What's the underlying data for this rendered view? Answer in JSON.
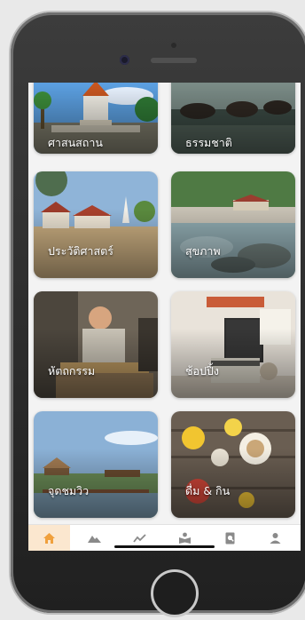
{
  "categories": [
    {
      "label": "ศาสนสถาน"
    },
    {
      "label": "ธรรมชาติ"
    },
    {
      "label": "ประวัติศาสตร์"
    },
    {
      "label": "สุขภาพ"
    },
    {
      "label": "หัตถกรรม"
    },
    {
      "label": "ช้อปปิ้ง"
    },
    {
      "label": "จุดชมวิว"
    },
    {
      "label": "ดื่ม & กิน"
    }
  ],
  "tabs": [
    {
      "icon": "home-icon",
      "active": true
    },
    {
      "icon": "mountain-icon",
      "active": false
    },
    {
      "icon": "trend-line-icon",
      "active": false
    },
    {
      "icon": "book-reader-icon",
      "active": false
    },
    {
      "icon": "document-search-icon",
      "active": false
    },
    {
      "icon": "user-icon",
      "active": false
    }
  ],
  "colors": {
    "accent": "#f0a03c",
    "tab_active_bg": "#fbe7cf",
    "tab_icon": "#8a8a8a"
  }
}
